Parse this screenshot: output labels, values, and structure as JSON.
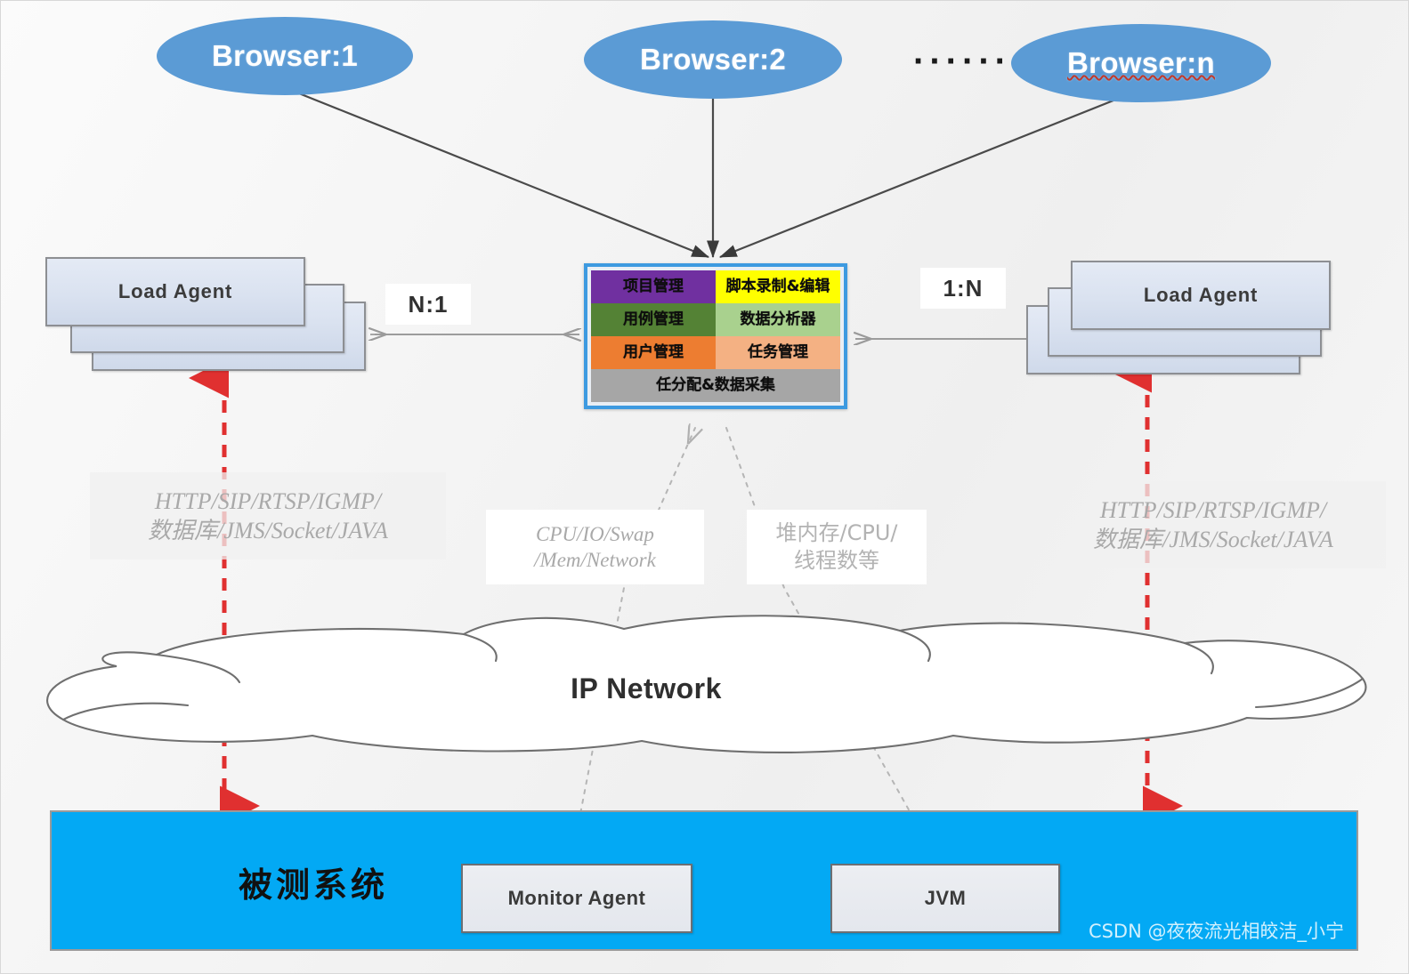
{
  "diagram": {
    "title": "Performance Testing Platform Architecture",
    "background_color": "#f2f2f2"
  },
  "browsers": [
    {
      "label": "Browser:1",
      "spellcheck_underline": false
    },
    {
      "label": "Browser:2",
      "spellcheck_underline": false
    },
    {
      "label": "Browser:n",
      "spellcheck_underline": true
    }
  ],
  "ellipsis": "······",
  "agents": {
    "left": {
      "label": "Load Agent"
    },
    "right": {
      "label": "Load Agent"
    }
  },
  "ratios": {
    "left": "N:1",
    "right": "1:N"
  },
  "controller": {
    "border_color": "#3d9ae0",
    "cells": [
      {
        "text": "项目管理",
        "bg": "#7030a0",
        "name": "project-management"
      },
      {
        "text": "脚本录制&编辑",
        "bg": "#ffff00",
        "name": "script-record-edit"
      },
      {
        "text": "用例管理",
        "bg": "#548235",
        "name": "testcase-management"
      },
      {
        "text": "数据分析器",
        "bg": "#a9d18e",
        "name": "data-analyzer"
      },
      {
        "text": "用户管理",
        "bg": "#ed7d31",
        "name": "user-management"
      },
      {
        "text": "任务管理",
        "bg": "#f4b183",
        "name": "task-management"
      },
      {
        "text": "任分配&数据采集",
        "bg": "#a6a6a6",
        "name": "task-dispatch-data-collect",
        "full_width": true
      }
    ]
  },
  "captions": {
    "protocol_left": {
      "line1": "HTTP/SIP/RTSP/IGMP/",
      "line2": "数据库/JMS/Socket/JAVA"
    },
    "protocol_right": {
      "line1": "HTTP/SIP/RTSP/IGMP/",
      "line2": "数据库/JMS/Socket/JAVA"
    },
    "metric_os": {
      "line1": "CPU/IO/Swap",
      "line2": "/Mem/Network"
    },
    "metric_jvm": {
      "line1": "堆内存/CPU/",
      "line2": "线程数等"
    }
  },
  "network": {
    "label": "IP Network"
  },
  "system_under_test": {
    "title": "被测系统",
    "background_color": "#03a9f4",
    "boxes": [
      {
        "label": "Monitor Agent",
        "name": "monitor-agent"
      },
      {
        "label": "JVM",
        "name": "jvm"
      }
    ]
  },
  "watermark": "CSDN @夜夜流光相皎洁_小宁"
}
